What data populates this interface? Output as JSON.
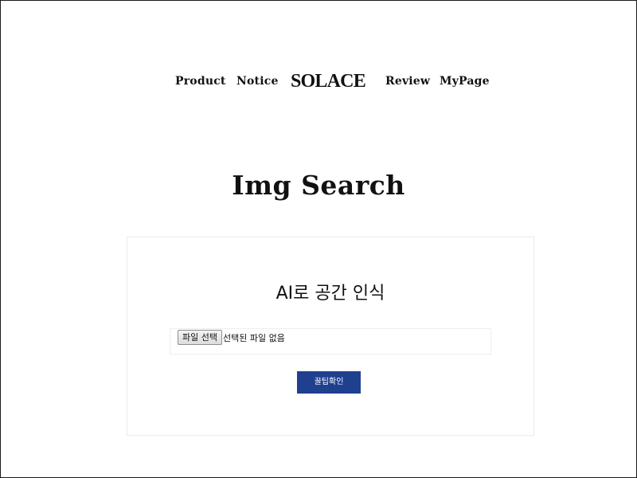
{
  "nav": {
    "product": "Product",
    "notice": "Notice",
    "logo": "SOLACE",
    "review": "Review",
    "mypage": "MyPage"
  },
  "page": {
    "title": "Img Search"
  },
  "card": {
    "heading": "AI로 공간 인식",
    "file_button_label": "파일 선택",
    "file_status": "선택된 파일 없음",
    "submit_label": "꿀팁확인"
  },
  "colors": {
    "submit_background": "#1f3f8f",
    "text": "#111111",
    "background": "#ffffff"
  }
}
